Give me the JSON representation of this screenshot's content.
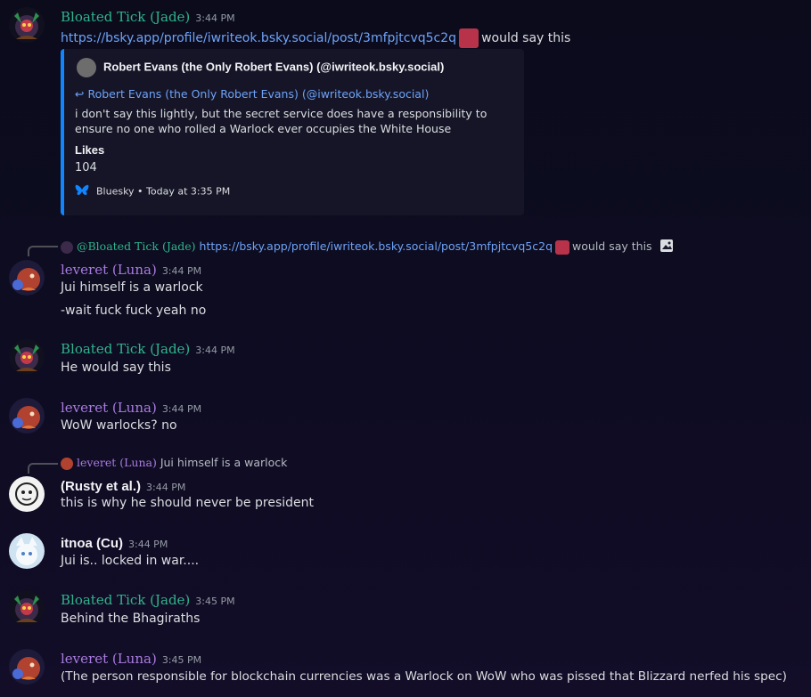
{
  "colors": {
    "jade": "#2fb58c",
    "luna": "#a97be0",
    "link": "#6ea3f7",
    "bluesky": "#1185fe"
  },
  "messages": [
    {
      "author": "Bloated Tick (Jade)",
      "time": "3:44 PM",
      "link": "https://bsky.app/profile/iwriteok.bsky.social/post/3mfpjtcvq5c2q",
      "after_emote": "would say this"
    },
    {
      "author": "leveret (Luna)",
      "time": "3:44 PM",
      "lines": [
        "Jui himself is a warlock",
        "-wait fuck fuck yeah no"
      ]
    },
    {
      "author": "Bloated Tick (Jade)",
      "time": "3:44 PM",
      "text": "He would say this"
    },
    {
      "author": "leveret (Luna)",
      "time": "3:44 PM",
      "text": "WoW warlocks? no"
    },
    {
      "author": "(Rusty et al.)",
      "time": "3:44 PM",
      "text": "this is why he should never be president"
    },
    {
      "author": "itnoa (Cu)",
      "time": "3:44 PM",
      "text": "Jui is.. locked in war...."
    },
    {
      "author": "Bloated Tick (Jade)",
      "time": "3:45 PM",
      "text": "Behind the Bhagiraths"
    },
    {
      "author": "leveret (Luna)",
      "time": "3:45 PM",
      "text": "(The person responsible for blockchain currencies was a Warlock on WoW who was pissed that Blizzard nerfed his spec)"
    }
  ],
  "embed": {
    "author": "Robert Evans (the Only Robert Evans) (@iwriteok.bsky.social)",
    "reply_to": "↩ Robert Evans (the Only Robert Evans) (@iwriteok.bsky.social)",
    "body": "i don't say this lightly, but the secret service does have a responsibility to ensure no one who rolled a Warlock ever occupies the White House",
    "field_label": "Likes",
    "field_value": "104",
    "footer": "Bluesky • Today at 3:35 PM"
  },
  "replies": [
    {
      "author": "@Bloated Tick (Jade)",
      "link": "https://bsky.app/profile/iwriteok.bsky.social/post/3mfpjtcvq5c2q",
      "after_emote": "would say this",
      "icon": "image-icon"
    },
    {
      "author": "leveret (Luna)",
      "text": "Jui himself is a warlock"
    }
  ]
}
